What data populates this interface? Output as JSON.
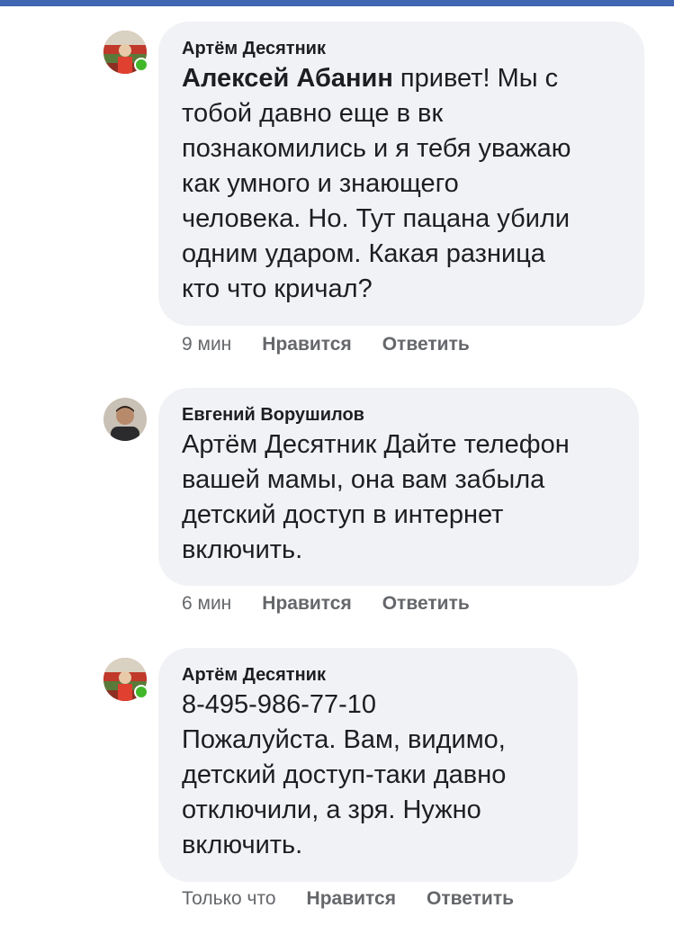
{
  "colors": {
    "top_bar": "#4267b2",
    "bubble_bg": "#f0f2f5",
    "online": "#42b72a",
    "meta_text": "#65676b"
  },
  "comments": [
    {
      "author": "Артём Десятник",
      "mention": "Алексей Абанин",
      "text": " привет! Мы с\nтобой давно еще в вк\nпознакомились и я тебя уважаю\nкак умного и знающего\nчеловека. Но. Тут пацана убили\nодним ударом. Какая разница\nкто что кричал?",
      "time": "9 мин",
      "like_label": "Нравится",
      "reply_label": "Ответить",
      "online": true,
      "avatar_icon": "stadium-avatar-icon"
    },
    {
      "author": "Евгений Ворушилов",
      "text": "Артём Десятник Дайте телефон\nвашей мамы, она вам забыла\nдетский доступ в интернет\nвключить.",
      "time": "6 мин",
      "like_label": "Нравится",
      "reply_label": "Ответить",
      "online": false,
      "avatar_icon": "person-avatar-icon"
    },
    {
      "author": "Артём Десятник",
      "text": "8-495-986-77-10\nПожалуйста. Вам, видимо,\nдетский доступ-таки давно\nотключили, а зря. Нужно\nвключить.",
      "time": "Только что",
      "like_label": "Нравится",
      "reply_label": "Ответить",
      "online": true,
      "avatar_icon": "stadium-avatar-icon"
    }
  ]
}
